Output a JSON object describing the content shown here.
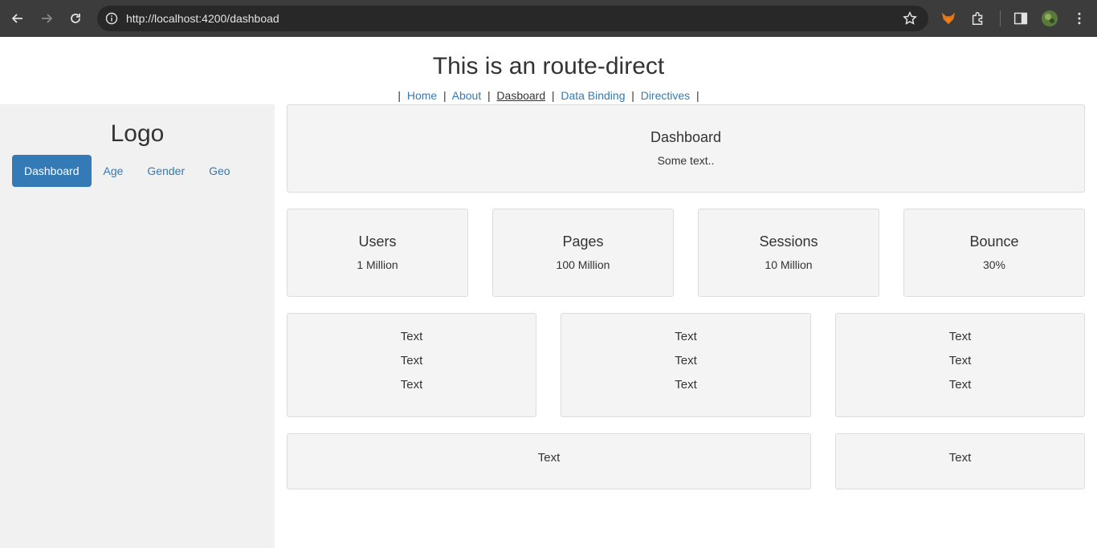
{
  "browser": {
    "url": "http://localhost:4200/dashboad"
  },
  "page": {
    "title": "This is an route-direct"
  },
  "topnav": {
    "items": [
      {
        "label": "Home"
      },
      {
        "label": "About"
      },
      {
        "label": "Dasboard"
      },
      {
        "label": "Data Binding"
      },
      {
        "label": "Directives"
      }
    ],
    "separator": "|",
    "active_index": 2
  },
  "sidebar": {
    "logo": "Logo",
    "pills": [
      {
        "label": "Dashboard"
      },
      {
        "label": "Age"
      },
      {
        "label": "Gender"
      },
      {
        "label": "Geo"
      }
    ],
    "active_index": 0
  },
  "hero": {
    "title": "Dashboard",
    "text": "Some text.."
  },
  "stats": [
    {
      "title": "Users",
      "value": "1 Million"
    },
    {
      "title": "Pages",
      "value": "100 Million"
    },
    {
      "title": "Sessions",
      "value": "10 Million"
    },
    {
      "title": "Bounce",
      "value": "30%"
    }
  ],
  "text_cards": [
    {
      "lines": [
        "Text",
        "Text",
        "Text"
      ]
    },
    {
      "lines": [
        "Text",
        "Text",
        "Text"
      ]
    },
    {
      "lines": [
        "Text",
        "Text",
        "Text"
      ]
    }
  ],
  "bottom_cards": [
    {
      "text": "Text"
    },
    {
      "text": "Text"
    }
  ],
  "colors": {
    "link": "#337ab7",
    "active_pill": "#337ab7",
    "sidebar_bg": "#f1f1f1",
    "card_bg": "#f4f4f4",
    "chrome_bg": "#3c3c3c"
  }
}
